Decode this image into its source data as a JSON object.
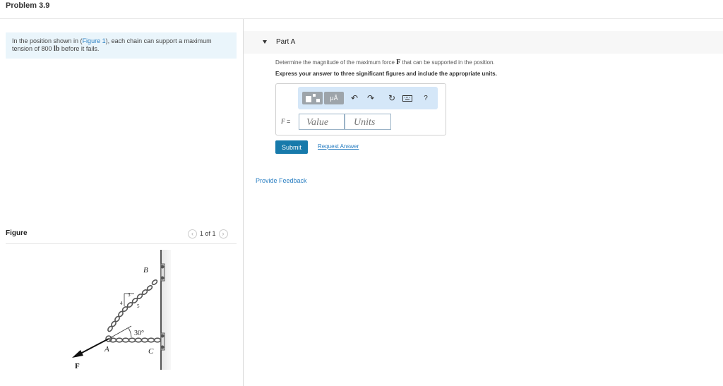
{
  "problem_title": "Problem 3.9",
  "intro": {
    "text_before": "In the position shown in (",
    "figure_link": "Figure 1",
    "text_after": "), each chain can support a maximum tension of 800 ",
    "unit": "lb",
    "text_end": " before it fails."
  },
  "figure_panel": {
    "label": "Figure",
    "pager_text": "1 of 1",
    "prev_icon": "chevron-left-icon",
    "next_icon": "chevron-right-icon",
    "diagram_labels": {
      "point_b": "B",
      "point_a": "A",
      "point_c": "C",
      "force": "F",
      "angle": "30°",
      "slope_rise": "3",
      "slope_run": "4",
      "slope_hyp": "5"
    }
  },
  "part_a": {
    "title": "Part A",
    "question_before": "Determine the magnitude of the maximum force ",
    "question_symbol": "F",
    "question_after": " that can be supported in the position.",
    "instruction": "Express your answer to three significant figures and include the appropriate units.",
    "toolbar": {
      "template_icon": "template-icon",
      "mu_label": "μÅ",
      "undo_icon": "undo-icon",
      "redo_icon": "redo-icon",
      "reset_icon": "reset-icon",
      "keyboard_icon": "keyboard-icon",
      "help_label": "?"
    },
    "f_label": "F",
    "f_equals": " =",
    "value_placeholder": "Value",
    "units_placeholder": "Units",
    "submit_label": "Submit",
    "request_label": "Request Answer"
  },
  "feedback_label": "Provide Feedback",
  "colors": {
    "link": "#2a7fc2",
    "submit": "#177aab",
    "toolbar": "#d5e7f8",
    "intro_bg": "#eaf5fb"
  }
}
